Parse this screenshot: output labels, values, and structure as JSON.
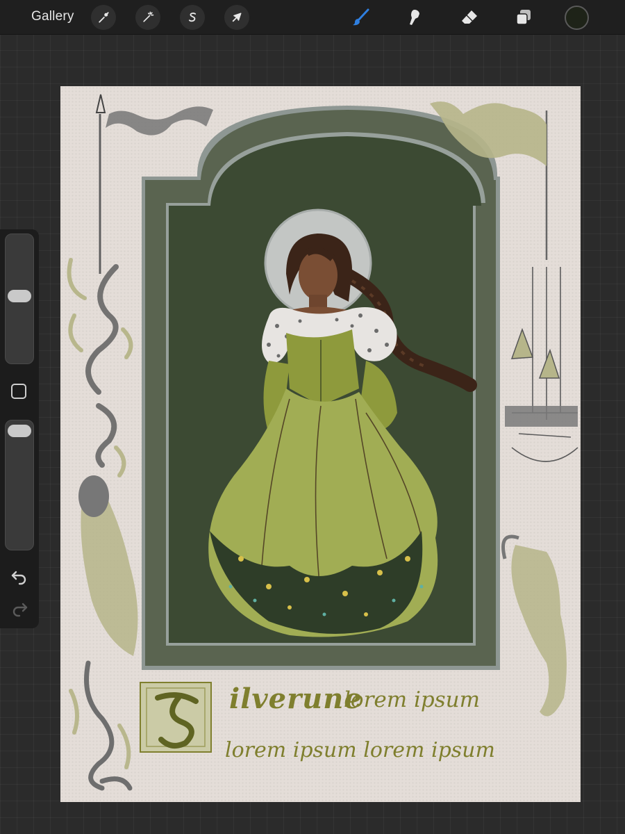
{
  "toolbar": {
    "gallery_label": "Gallery",
    "left_tools": [
      {
        "icon": "wrench-icon",
        "name": "actions"
      },
      {
        "icon": "magic-wand-icon",
        "name": "adjustments"
      },
      {
        "icon": "selection-s-icon",
        "name": "selection"
      },
      {
        "icon": "arrow-cursor-icon",
        "name": "transform"
      }
    ],
    "right_tools": [
      {
        "icon": "brush-icon",
        "name": "brush",
        "active": true
      },
      {
        "icon": "smudge-icon",
        "name": "smudge"
      },
      {
        "icon": "eraser-icon",
        "name": "eraser"
      },
      {
        "icon": "layers-icon",
        "name": "layers"
      }
    ],
    "current_color": "#1e2318",
    "active_color": "#2f7fe0"
  },
  "sidebar": {
    "brush_size_level": 0.55,
    "opacity_level": 0.95,
    "undo_icon": "undo-arrow-icon",
    "redo_icon": "redo-arrow-icon"
  },
  "artwork": {
    "title_word": "ilverune",
    "title_rest": "lorem ipsum",
    "line2": "lorem ipsum lorem ipsum",
    "colors": {
      "parchment": "#e4ddd8",
      "arch_outer": "#5a6450",
      "arch_inner": "#3c4a33",
      "dress": "#9aa84d",
      "text": "#7f7f2e"
    }
  }
}
